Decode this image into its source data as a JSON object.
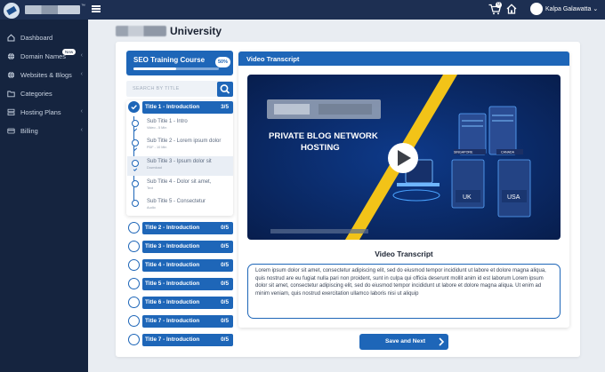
{
  "header": {
    "user_name": "Kalpa Galawatta",
    "cart_count": "0"
  },
  "sidebar": {
    "items": [
      {
        "label": "Dashboard",
        "has_chevron": false
      },
      {
        "label": "Domain Names",
        "badge": "New",
        "has_chevron": true
      },
      {
        "label": "Websites & Blogs",
        "has_chevron": true
      },
      {
        "label": "Categories",
        "has_chevron": false
      },
      {
        "label": "Hosting Plans",
        "has_chevron": true
      },
      {
        "label": "Billing",
        "has_chevron": true
      }
    ]
  },
  "page": {
    "title": "University"
  },
  "course": {
    "title": "SEO Training Course",
    "progress_label": "50%",
    "progress": 0.5,
    "search_placeholder": "SEARCH BY TITLE",
    "sections": [
      {
        "title": "Title 1 - Introduction",
        "count": "3/5",
        "done": true
      },
      {
        "title": "Title 2 - Introduction",
        "count": "0/5",
        "done": false
      },
      {
        "title": "Title 3 - Introduction",
        "count": "0/5",
        "done": false
      },
      {
        "title": "Title 4 - Introduction",
        "count": "0/5",
        "done": false
      },
      {
        "title": "Title 5 - Introduction",
        "count": "0/5",
        "done": false
      },
      {
        "title": "Title 6 - Introduction",
        "count": "0/5",
        "done": false
      },
      {
        "title": "Title 7 - Introduction",
        "count": "0/5",
        "done": false
      },
      {
        "title": "Title 7 - Introduction",
        "count": "0/5",
        "done": false
      }
    ],
    "subtitles": [
      {
        "title": "Sub Title 1 - Intro",
        "meta": "Video - 5 Min",
        "done": true
      },
      {
        "title": "Sub Title 2 - Lorem ipsum dolor",
        "meta": "PDF - 10 Min",
        "done": true
      },
      {
        "title": "Sub Title 3 - Ipsum dolor sit",
        "meta": "Download",
        "done": true
      },
      {
        "title": "Sub Title 4 - Dolor sit amet,",
        "meta": "Text",
        "done": false
      },
      {
        "title": "Sub Title 5 - Consectetur",
        "meta": "Audio",
        "done": false
      }
    ]
  },
  "transcript": {
    "header": "Video Transcript",
    "video_headline_1": "PRIVATE BLOG NETWORK",
    "video_headline_2": "HOSTING",
    "server_labels": [
      "SINGAPORE",
      "CANADA",
      "UK",
      "USA"
    ],
    "title": "Video Transcript",
    "text": "Lorem ipsum dolor sit amet, consectetur adipiscing elit, sed do eiusmod tempor incididunt ut labore et dolore magna aliqua, quis nostrud are eu fugiat nulla pari non proident, sunt in culpa qui officia deserunt mollit anim id est laborum Lorem ipsum dolor sit amet, consectetur adipiscing elit, sed do eiusmod tempor incididunt ut labore et dolore magna aliqua. Ut enim ad minim veniam, quis nostrud exercitation ullamco laboris nisi ut aliquip"
  },
  "actions": {
    "save_next": "Save and Next"
  },
  "colors": {
    "primary": "#1e66b8",
    "topbar": "#1d2f52",
    "sidebar": "#15243f",
    "accent_yellow": "#f2c318"
  }
}
